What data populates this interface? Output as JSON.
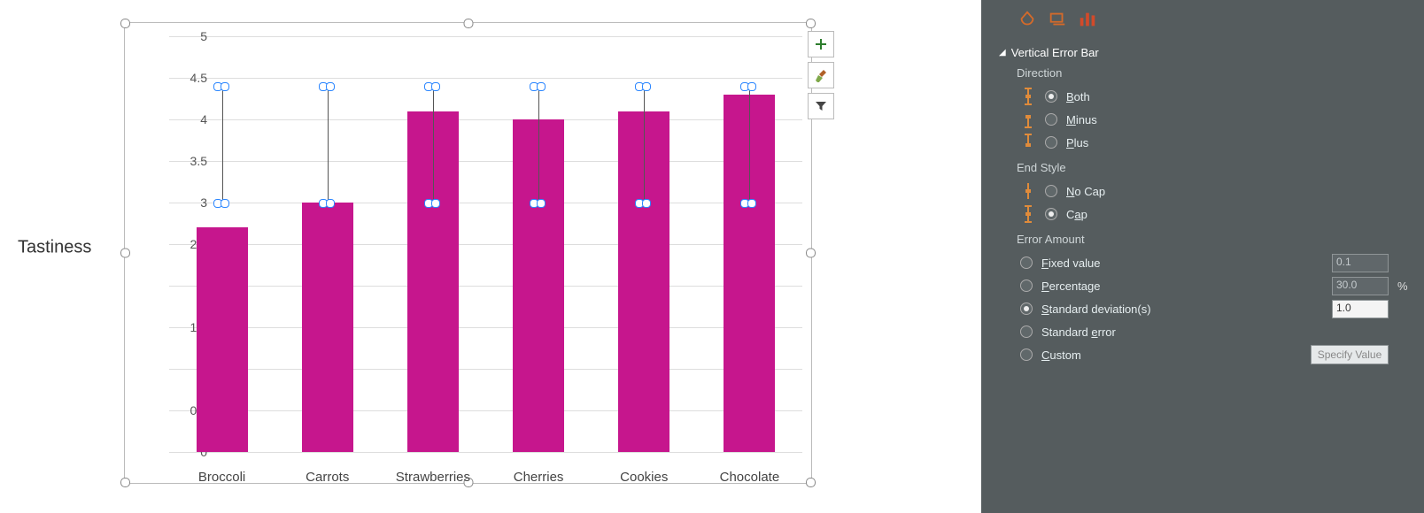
{
  "chart_data": {
    "type": "bar",
    "categories": [
      "Broccoli",
      "Carrots",
      "Strawberries",
      "Cherries",
      "Cookies",
      "Chocolate"
    ],
    "values": [
      2.7,
      3.0,
      4.1,
      4.0,
      4.1,
      4.3
    ],
    "error_bar": {
      "upper": 4.4,
      "lower": 3.0,
      "type": "standard_deviation",
      "value": 1.0
    },
    "ylabel": "Tastiness",
    "ylim": [
      0,
      5
    ],
    "yticks": [
      0,
      0.5,
      1,
      1.5,
      2,
      2.5,
      3,
      3.5,
      4,
      4.5,
      5
    ],
    "bar_color": "#c6168d"
  },
  "side_buttons": {
    "add": "+",
    "brush": "✎",
    "filter": "▼"
  },
  "pane": {
    "title": "Vertical Error Bar",
    "section_direction": "Direction",
    "dir_both": "Both",
    "dir_minus": "Minus",
    "dir_plus": "Plus",
    "section_endstyle": "End Style",
    "end_nocap": "No Cap",
    "end_cap": "Cap",
    "section_amount": "Error Amount",
    "amt_fixed": "Fixed value",
    "amt_fixed_val": "0.1",
    "amt_percent": "Percentage",
    "amt_percent_val": "30.0",
    "amt_percent_suffix": "%",
    "amt_stddev": "Standard deviation(s)",
    "amt_stddev_val": "1.0",
    "amt_stderr": "Standard error",
    "amt_custom": "Custom",
    "amt_custom_btn": "Specify Value"
  }
}
